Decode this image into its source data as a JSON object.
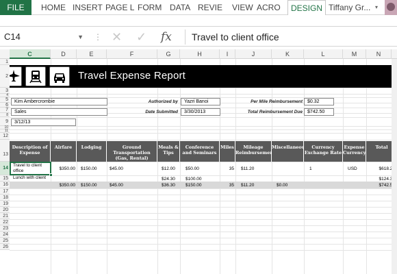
{
  "ribbon": {
    "tabs": [
      "FILE",
      "HOME",
      "INSERT",
      "PAGE L",
      "FORM",
      "DATA",
      "REVIE",
      "VIEW",
      "ACRO",
      "DESIGN",
      "Tiffany Gr..."
    ]
  },
  "formula_bar": {
    "name_box": "C14",
    "fx": "fx",
    "formula": "Travel to client office"
  },
  "columns": [
    "C",
    "D",
    "E",
    "F",
    "G",
    "H",
    "I",
    "J",
    "K",
    "L",
    "M",
    "N"
  ],
  "rows": [
    "1",
    "2",
    "3",
    "4",
    "5",
    "6",
    "7",
    "8",
    "9",
    "10",
    "11",
    "12",
    "13",
    "14",
    "15",
    "16",
    "17",
    "18",
    "19",
    "20",
    "21",
    "22",
    "23",
    "24",
    "25",
    "26"
  ],
  "report": {
    "title": "Travel Expense Report",
    "icons": [
      "airplane-icon",
      "train-icon",
      "car-icon"
    ]
  },
  "info": {
    "name": "Kim Ambercrombie",
    "department": "Sales",
    "date": "3/12/13",
    "authorized_label": "Authorized by",
    "authorized_value": "Yazri Banoi",
    "date_submitted_label": "Date Submitted",
    "date_submitted_value": "3/30/2013",
    "per_mile_label": "Per Mile Reimbursement",
    "per_mile_value": "$0.32",
    "total_due_label": "Total Reimbursement Due",
    "total_due_value": "$742.50"
  },
  "table": {
    "headers": [
      "Description of Expense",
      "Airfare",
      "Lodging",
      "Ground Transportation (Gas, Rental)",
      "Meals & Tips",
      "Conference and Seminars",
      "Miles",
      "Mileage Reimbursement",
      "Miscellaneous",
      "Currency Exchange Rate",
      "Expense Currency",
      "Total"
    ],
    "rows": [
      [
        "Travel to client office",
        "$350.00",
        "$150.00",
        "$45.00",
        "$12.00",
        "$50.00",
        "35",
        "$11.20",
        "",
        "1",
        "USD",
        "$618.20"
      ],
      [
        "Lunch with client",
        "",
        "",
        "",
        "$24.30",
        "$100.00",
        "",
        "",
        "",
        "",
        "",
        "$124.30"
      ]
    ],
    "totals": [
      "",
      "$350.00",
      "$150.00",
      "$45.00",
      "$36.30",
      "$150.00",
      "35",
      "$11.20",
      "$0.00",
      "",
      "",
      "$742.50"
    ]
  },
  "colors": {
    "excel_green": "#217346",
    "banner": "#000000",
    "header_fill": "#595959",
    "totals_fill": "#d9d9d9"
  }
}
